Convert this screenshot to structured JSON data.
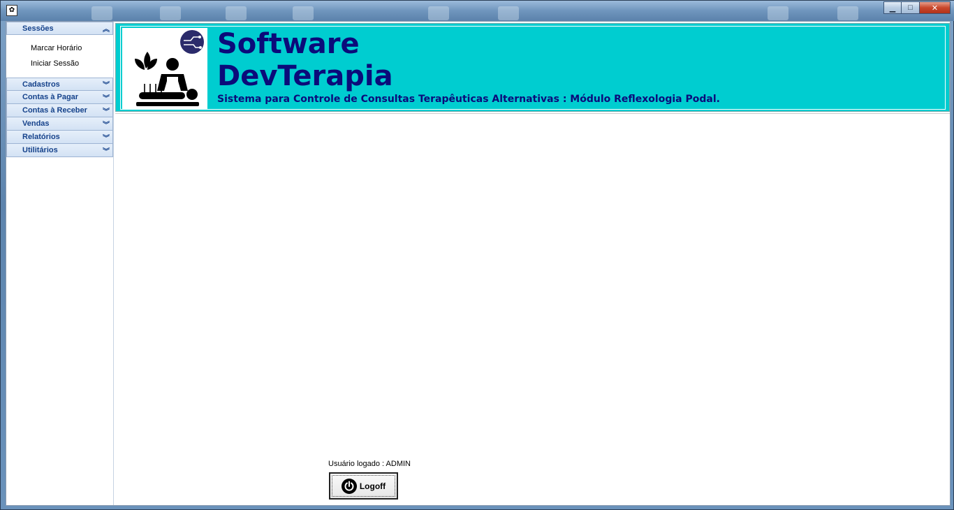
{
  "window": {
    "app_icon_glyph": "✿",
    "minimize_glyph": "▁",
    "maximize_glyph": "□",
    "close_glyph": "✕"
  },
  "sidebar": {
    "groups": [
      {
        "label": "Sessões",
        "expanded": true,
        "items": [
          "Marcar Horário",
          "Iniciar Sessão"
        ]
      },
      {
        "label": "Cadastros",
        "expanded": false
      },
      {
        "label": "Contas à Pagar",
        "expanded": false
      },
      {
        "label": "Contas à Receber",
        "expanded": false
      },
      {
        "label": "Vendas",
        "expanded": false
      },
      {
        "label": "Relatórios",
        "expanded": false
      },
      {
        "label": "Utilitários",
        "expanded": false
      }
    ],
    "chevron_up": "︽",
    "chevron_down": "︾"
  },
  "banner": {
    "title_line1": "Software",
    "title_line2": "DevTerapia",
    "subtitle": "Sistema para Controle de Consultas Terapêuticas Alternativas : Módulo Reflexologia Podal.",
    "background": "#00cdd0",
    "text_color": "#0b0b7a"
  },
  "footer": {
    "user_label": "Usuário logado : ADMIN",
    "logoff_label": "Logoff"
  },
  "icons": {
    "logo": "massage-therapy-icon",
    "badge": "circuit-badge-icon",
    "logoff": "power-icon"
  }
}
